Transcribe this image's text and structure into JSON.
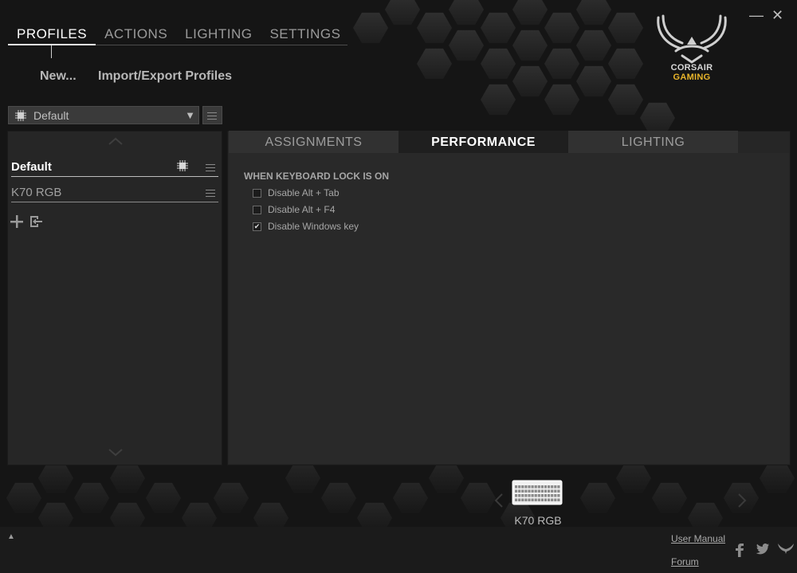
{
  "top_nav": {
    "items": [
      {
        "label": "PROFILES"
      },
      {
        "label": "ACTIONS"
      },
      {
        "label": "LIGHTING"
      },
      {
        "label": "SETTINGS"
      }
    ]
  },
  "sub_nav": {
    "new_label": "New...",
    "import_export_label": "Import/Export Profiles"
  },
  "window": {
    "minimize_glyph": "—",
    "close_glyph": "✕"
  },
  "logo": {
    "line1": "CORSAIR",
    "line2": "GAMING",
    "colors": {
      "gray": "#d8d8d8",
      "gold": "#e9b52a"
    }
  },
  "profile_select": {
    "selected": "Default",
    "arrow": "▼"
  },
  "profiles": [
    {
      "name": "Default",
      "active": true
    },
    {
      "name": "K70 RGB",
      "active": false
    }
  ],
  "panel_tabs": [
    {
      "label": "ASSIGNMENTS"
    },
    {
      "label": "PERFORMANCE"
    },
    {
      "label": "LIGHTING"
    }
  ],
  "performance": {
    "section_title": "WHEN KEYBOARD LOCK IS ON",
    "options": [
      {
        "label": "Disable Alt + Tab",
        "checked": false
      },
      {
        "label": "Disable Alt + F4",
        "checked": false
      },
      {
        "label": "Disable Windows key",
        "checked": true
      }
    ]
  },
  "device": {
    "name": "K70 RGB"
  },
  "footer": {
    "user_manual": "User Manual",
    "forum": "Forum",
    "expand_glyph": "▲",
    "social": [
      "facebook-icon",
      "twitter-icon",
      "corsair-icon"
    ]
  },
  "icons": {
    "check": "✔",
    "chevron_up": "chevron-up-icon",
    "chevron_down": "chevron-down-icon"
  }
}
